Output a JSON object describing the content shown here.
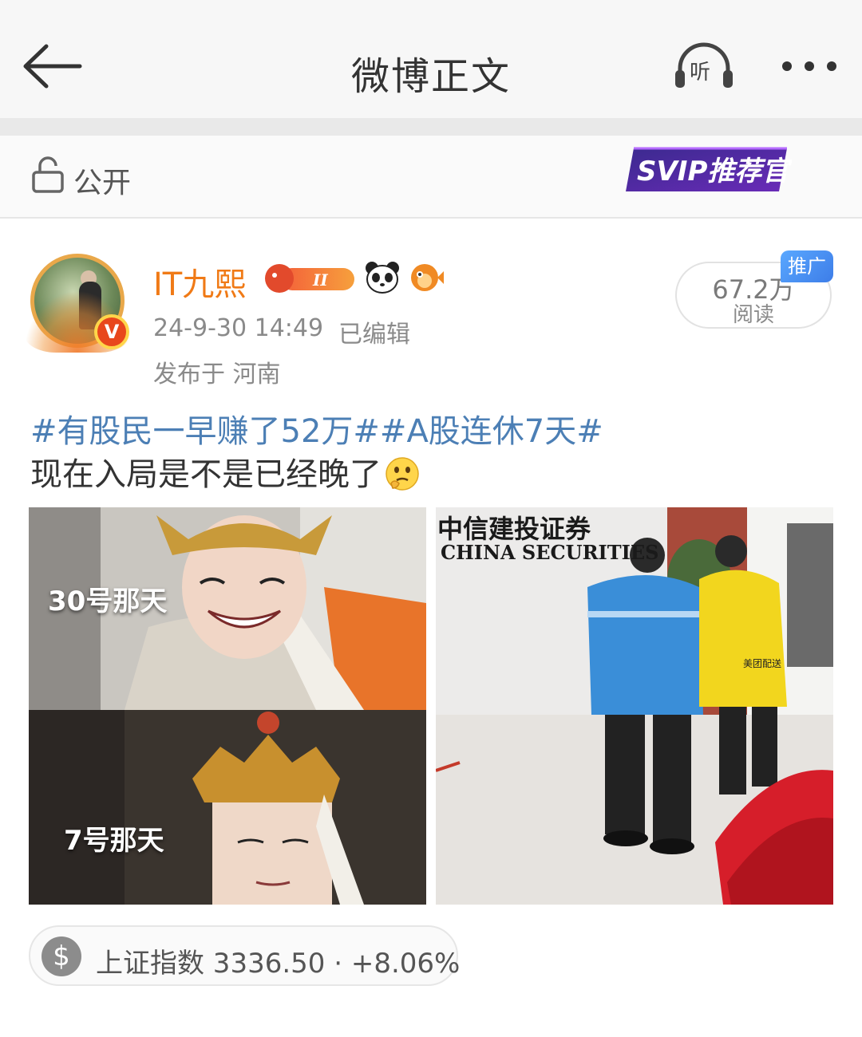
{
  "header": {
    "title": "微博正文",
    "listen_label": "听"
  },
  "visibility": {
    "label": "公开",
    "svip_badge_text": "SVIP推荐官"
  },
  "author": {
    "name": "IT九熙",
    "level_badge": "II",
    "verified_mark": "V",
    "time": "24-9-30 14:49",
    "edited": "已编辑",
    "location": "发布于 河南"
  },
  "stats": {
    "reads": "67.2万",
    "reads_label": "阅读",
    "promo_tag": "推广"
  },
  "post": {
    "tags": "#有股民一早赚了52万##A股连休7天#",
    "body": "现在入局是不是已经晚了",
    "emoji": "thinking-face-icon"
  },
  "images": {
    "left_caption_top": "30号那天",
    "left_caption_bottom": "7号那天",
    "right_sign_cn": "中信建投证券",
    "right_sign_en": "CHINA SECURITIES",
    "right_jacket_text": "美团配送"
  },
  "stock": {
    "text": "上证指数 3336.50 · +8.06%"
  }
}
